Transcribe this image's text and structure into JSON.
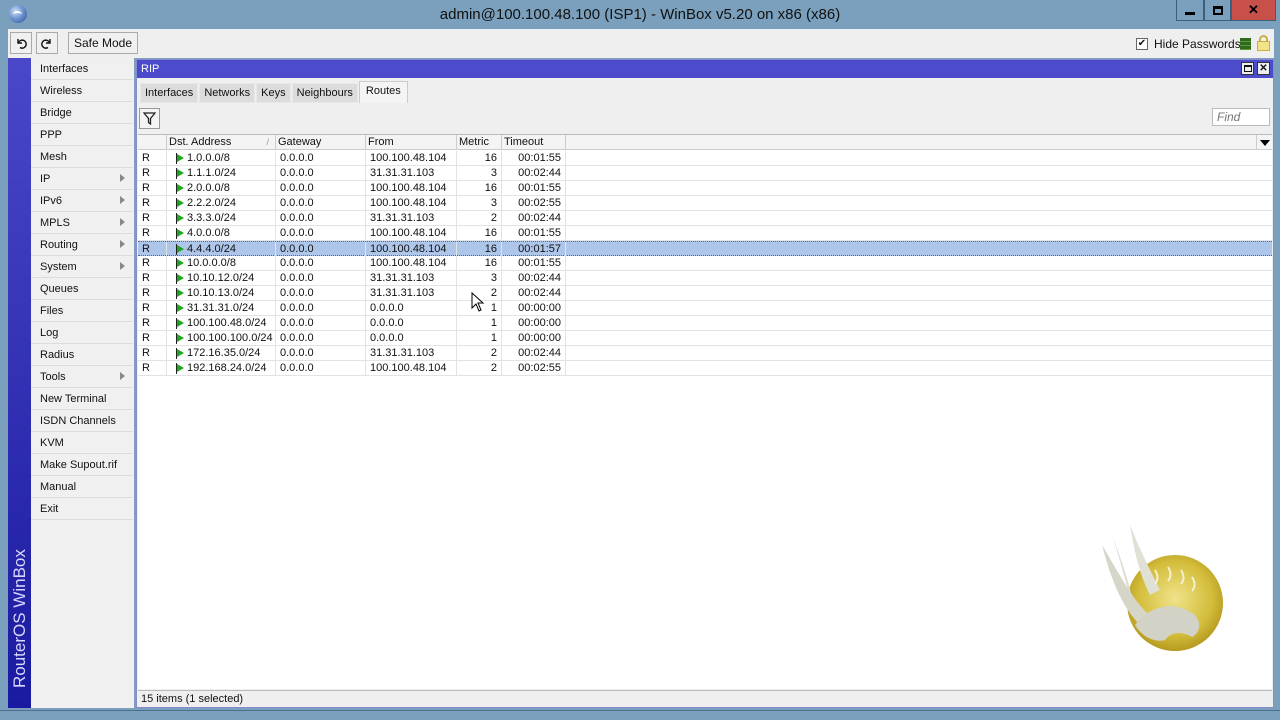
{
  "window": {
    "title": "admin@100.100.48.100 (ISP1) - WinBox v5.20 on x86 (x86)",
    "controls": [
      "minimize",
      "maximize",
      "close"
    ]
  },
  "toolbar": {
    "undo_icon": "undo-icon",
    "redo_icon": "redo-icon",
    "safe_mode_label": "Safe Mode",
    "hide_passwords_label": "Hide Passwords",
    "hide_passwords_checked": true,
    "checkmark": "✔"
  },
  "sidebar": {
    "brand": "RouterOS WinBox",
    "items": [
      {
        "label": "Interfaces",
        "submenu": false
      },
      {
        "label": "Wireless",
        "submenu": false
      },
      {
        "label": "Bridge",
        "submenu": false
      },
      {
        "label": "PPP",
        "submenu": false
      },
      {
        "label": "Mesh",
        "submenu": false
      },
      {
        "label": "IP",
        "submenu": true
      },
      {
        "label": "IPv6",
        "submenu": true
      },
      {
        "label": "MPLS",
        "submenu": true
      },
      {
        "label": "Routing",
        "submenu": true
      },
      {
        "label": "System",
        "submenu": true
      },
      {
        "label": "Queues",
        "submenu": false
      },
      {
        "label": "Files",
        "submenu": false
      },
      {
        "label": "Log",
        "submenu": false
      },
      {
        "label": "Radius",
        "submenu": false
      },
      {
        "label": "Tools",
        "submenu": true
      },
      {
        "label": "New Terminal",
        "submenu": false
      },
      {
        "label": "ISDN Channels",
        "submenu": false
      },
      {
        "label": "KVM",
        "submenu": false
      },
      {
        "label": "Make Supout.rif",
        "submenu": false
      },
      {
        "label": "Manual",
        "submenu": false
      },
      {
        "label": "Exit",
        "submenu": false
      }
    ]
  },
  "rip": {
    "title": "RIP",
    "tabs": [
      {
        "label": "Interfaces",
        "active": false
      },
      {
        "label": "Networks",
        "active": false
      },
      {
        "label": "Keys",
        "active": false
      },
      {
        "label": "Neighbours",
        "active": false
      },
      {
        "label": "Routes",
        "active": true
      }
    ],
    "find_placeholder": "Find",
    "columns": [
      "",
      "Dst. Address",
      "Gateway",
      "From",
      "Metric",
      "Timeout"
    ],
    "sort_indicator": "/",
    "rows": [
      {
        "flag": "R",
        "dst": "1.0.0.0/8",
        "gateway": "0.0.0.0",
        "from": "100.100.48.104",
        "metric": "16",
        "timeout": "00:01:55",
        "selected": false
      },
      {
        "flag": "R",
        "dst": "1.1.1.0/24",
        "gateway": "0.0.0.0",
        "from": "31.31.31.103",
        "metric": "3",
        "timeout": "00:02:44",
        "selected": false
      },
      {
        "flag": "R",
        "dst": "2.0.0.0/8",
        "gateway": "0.0.0.0",
        "from": "100.100.48.104",
        "metric": "16",
        "timeout": "00:01:55",
        "selected": false
      },
      {
        "flag": "R",
        "dst": "2.2.2.0/24",
        "gateway": "0.0.0.0",
        "from": "100.100.48.104",
        "metric": "3",
        "timeout": "00:02:55",
        "selected": false
      },
      {
        "flag": "R",
        "dst": "3.3.3.0/24",
        "gateway": "0.0.0.0",
        "from": "31.31.31.103",
        "metric": "2",
        "timeout": "00:02:44",
        "selected": false
      },
      {
        "flag": "R",
        "dst": "4.0.0.0/8",
        "gateway": "0.0.0.0",
        "from": "100.100.48.104",
        "metric": "16",
        "timeout": "00:01:55",
        "selected": false
      },
      {
        "flag": "R",
        "dst": "4.4.4.0/24",
        "gateway": "0.0.0.0",
        "from": "100.100.48.104",
        "metric": "16",
        "timeout": "00:01:57",
        "selected": true
      },
      {
        "flag": "R",
        "dst": "10.0.0.0/8",
        "gateway": "0.0.0.0",
        "from": "100.100.48.104",
        "metric": "16",
        "timeout": "00:01:55",
        "selected": false
      },
      {
        "flag": "R",
        "dst": "10.10.12.0/24",
        "gateway": "0.0.0.0",
        "from": "31.31.31.103",
        "metric": "3",
        "timeout": "00:02:44",
        "selected": false
      },
      {
        "flag": "R",
        "dst": "10.10.13.0/24",
        "gateway": "0.0.0.0",
        "from": "31.31.31.103",
        "metric": "2",
        "timeout": "00:02:44",
        "selected": false
      },
      {
        "flag": "R",
        "dst": "31.31.31.0/24",
        "gateway": "0.0.0.0",
        "from": "0.0.0.0",
        "metric": "1",
        "timeout": "00:00:00",
        "selected": false
      },
      {
        "flag": "R",
        "dst": "100.100.48.0/24",
        "gateway": "0.0.0.0",
        "from": "0.0.0.0",
        "metric": "1",
        "timeout": "00:00:00",
        "selected": false
      },
      {
        "flag": "R",
        "dst": "100.100.100.0/24",
        "gateway": "0.0.0.0",
        "from": "0.0.0.0",
        "metric": "1",
        "timeout": "00:00:00",
        "selected": false
      },
      {
        "flag": "R",
        "dst": "172.16.35.0/24",
        "gateway": "0.0.0.0",
        "from": "31.31.31.103",
        "metric": "2",
        "timeout": "00:02:44",
        "selected": false
      },
      {
        "flag": "R",
        "dst": "192.168.24.0/24",
        "gateway": "0.0.0.0",
        "from": "100.100.48.104",
        "metric": "2",
        "timeout": "00:02:55",
        "selected": false
      }
    ],
    "status": "15 items (1 selected)"
  },
  "colors": {
    "titlebar": "#7aa0bd",
    "window_title_bar": "#4b4bcb",
    "selected_row": "#aec6ea",
    "route_flag": "#1fa51f",
    "close_button": "#c7504a"
  }
}
